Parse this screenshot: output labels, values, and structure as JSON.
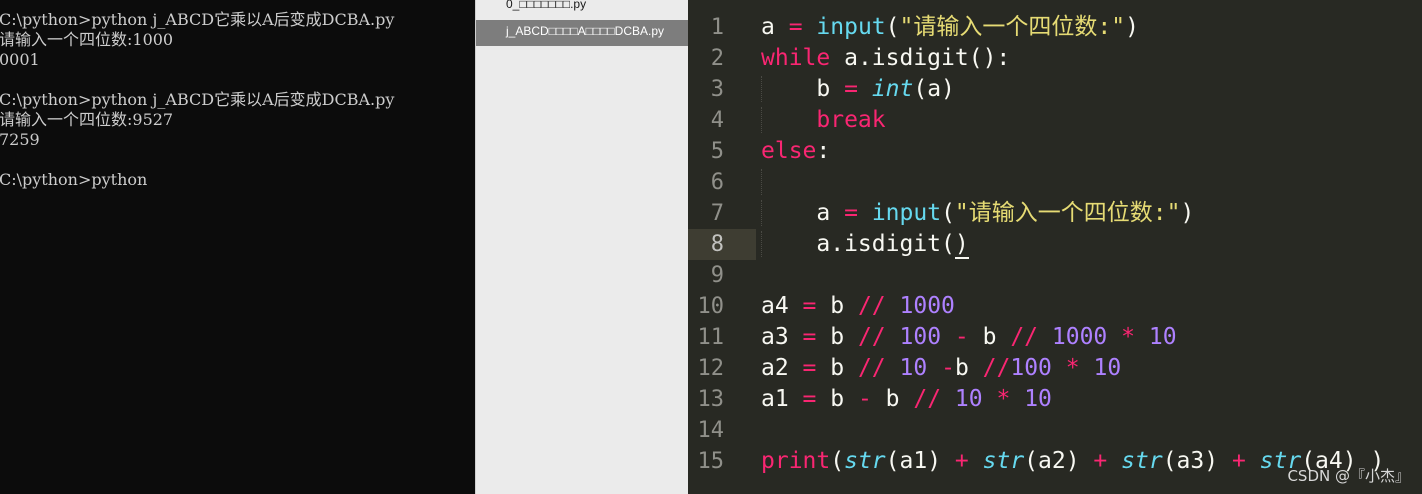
{
  "terminal": {
    "lines": [
      "C:\\python>python j_ABCD它乘以A后变成DCBA.py",
      "请输入一个四位数:1000",
      "0001",
      "",
      "C:\\python>python j_ABCD它乘以A后变成DCBA.py",
      "请输入一个四位数:9527",
      "7259",
      "",
      "C:\\python>python"
    ]
  },
  "files": [
    {
      "name": "0_□□□□□□□.py",
      "selected": false
    },
    {
      "name": "j_ABCD□□□□A□□□□DCBA.py",
      "selected": true
    }
  ],
  "editor": {
    "line_numbers": [
      "1",
      "2",
      "3",
      "4",
      "5",
      "6",
      "7",
      "8",
      "9",
      "10",
      "11",
      "12",
      "13",
      "14",
      "15"
    ],
    "current_line": "8",
    "code": [
      [
        {
          "t": "a ",
          "c": ""
        },
        {
          "t": "=",
          "c": "op"
        },
        {
          "t": " ",
          "c": ""
        },
        {
          "t": "input",
          "c": "bf"
        },
        {
          "t": "(",
          "c": ""
        },
        {
          "t": "\"请输入一个四位数:\"",
          "c": "str"
        },
        {
          "t": ")",
          "c": ""
        }
      ],
      [
        {
          "t": "while",
          "c": "kw"
        },
        {
          "t": " a.",
          "c": ""
        },
        {
          "t": "isdigit",
          "c": ""
        },
        {
          "t": "():",
          "c": ""
        }
      ],
      [
        {
          "t": "    b ",
          "c": "",
          "guide": true
        },
        {
          "t": "=",
          "c": "op"
        },
        {
          "t": " ",
          "c": ""
        },
        {
          "t": "int",
          "c": "ty"
        },
        {
          "t": "(a)",
          "c": ""
        }
      ],
      [
        {
          "t": "    ",
          "c": "",
          "guide": true
        },
        {
          "t": "break",
          "c": "kw"
        }
      ],
      [
        {
          "t": "else",
          "c": "kw"
        },
        {
          "t": ":",
          "c": ""
        }
      ],
      [
        {
          "t": "    ",
          "c": "",
          "guide": true
        }
      ],
      [
        {
          "t": "    a ",
          "c": "",
          "guide": true
        },
        {
          "t": "=",
          "c": "op"
        },
        {
          "t": " ",
          "c": ""
        },
        {
          "t": "input",
          "c": "bf"
        },
        {
          "t": "(",
          "c": ""
        },
        {
          "t": "\"请输入一个四位数:\"",
          "c": "str"
        },
        {
          "t": ")",
          "c": ""
        }
      ],
      [
        {
          "t": "    a.isdigit(",
          "c": "",
          "guide": true
        },
        {
          "t": ")",
          "c": "",
          "ul": true
        }
      ],
      [],
      [
        {
          "t": "a4 ",
          "c": ""
        },
        {
          "t": "=",
          "c": "op"
        },
        {
          "t": " b ",
          "c": ""
        },
        {
          "t": "//",
          "c": "op"
        },
        {
          "t": " ",
          "c": ""
        },
        {
          "t": "1000",
          "c": "num"
        }
      ],
      [
        {
          "t": "a3 ",
          "c": ""
        },
        {
          "t": "=",
          "c": "op"
        },
        {
          "t": " b ",
          "c": ""
        },
        {
          "t": "//",
          "c": "op"
        },
        {
          "t": " ",
          "c": ""
        },
        {
          "t": "100",
          "c": "num"
        },
        {
          "t": " ",
          "c": ""
        },
        {
          "t": "-",
          "c": "op"
        },
        {
          "t": " b ",
          "c": ""
        },
        {
          "t": "//",
          "c": "op"
        },
        {
          "t": " ",
          "c": ""
        },
        {
          "t": "1000",
          "c": "num"
        },
        {
          "t": " ",
          "c": ""
        },
        {
          "t": "*",
          "c": "op"
        },
        {
          "t": " ",
          "c": ""
        },
        {
          "t": "10",
          "c": "num"
        }
      ],
      [
        {
          "t": "a2 ",
          "c": ""
        },
        {
          "t": "=",
          "c": "op"
        },
        {
          "t": " b ",
          "c": ""
        },
        {
          "t": "//",
          "c": "op"
        },
        {
          "t": " ",
          "c": ""
        },
        {
          "t": "10",
          "c": "num"
        },
        {
          "t": " ",
          "c": ""
        },
        {
          "t": "-",
          "c": "op"
        },
        {
          "t": "b ",
          "c": ""
        },
        {
          "t": "//",
          "c": "op"
        },
        {
          "t": "100",
          "c": "num"
        },
        {
          "t": " ",
          "c": ""
        },
        {
          "t": "*",
          "c": "op"
        },
        {
          "t": " ",
          "c": ""
        },
        {
          "t": "10",
          "c": "num"
        }
      ],
      [
        {
          "t": "a1 ",
          "c": ""
        },
        {
          "t": "=",
          "c": "op"
        },
        {
          "t": " b ",
          "c": ""
        },
        {
          "t": "-",
          "c": "op"
        },
        {
          "t": " b ",
          "c": ""
        },
        {
          "t": "//",
          "c": "op"
        },
        {
          "t": " ",
          "c": ""
        },
        {
          "t": "10",
          "c": "num"
        },
        {
          "t": " ",
          "c": ""
        },
        {
          "t": "*",
          "c": "op"
        },
        {
          "t": " ",
          "c": ""
        },
        {
          "t": "10",
          "c": "num"
        }
      ],
      [],
      [
        {
          "t": "print",
          "c": "kw"
        },
        {
          "t": "(",
          "c": ""
        },
        {
          "t": "str",
          "c": "ty"
        },
        {
          "t": "(a1) ",
          "c": ""
        },
        {
          "t": "+",
          "c": "op"
        },
        {
          "t": " ",
          "c": ""
        },
        {
          "t": "str",
          "c": "ty"
        },
        {
          "t": "(a2) ",
          "c": ""
        },
        {
          "t": "+",
          "c": "op"
        },
        {
          "t": " ",
          "c": ""
        },
        {
          "t": "str",
          "c": "ty"
        },
        {
          "t": "(a3) ",
          "c": ""
        },
        {
          "t": "+",
          "c": "op"
        },
        {
          "t": " ",
          "c": ""
        },
        {
          "t": "str",
          "c": "ty"
        },
        {
          "t": "(a4) )",
          "c": ""
        }
      ]
    ]
  },
  "watermark": "CSDN @『小杰』",
  "colors": {
    "terminal_bg": "#0c0c0c",
    "editor_bg": "#282923",
    "keyword": "#f92672",
    "builtin": "#66d9ef",
    "string": "#e6db74",
    "number": "#ae81ff"
  }
}
